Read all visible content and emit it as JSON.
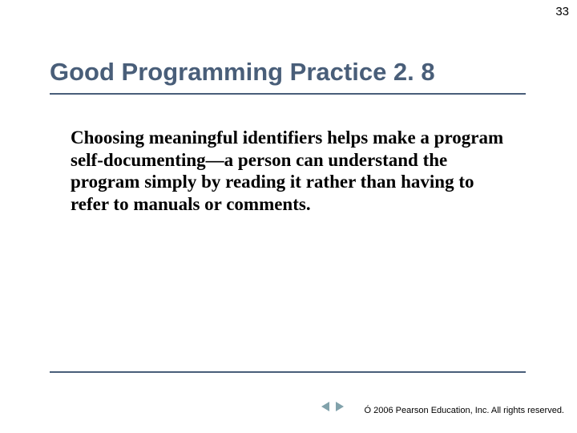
{
  "page": {
    "number": "33"
  },
  "title": "Good Programming Practice 2. 8",
  "body": "Choosing meaningful identifiers helps make a program self-documenting—a person can understand the program simply by reading it rather than having to refer to manuals or comments.",
  "footer": {
    "copyright": " 2006 Pearson Education, Inc.  All rights reserved.",
    "copyright_symbol": "Ó"
  },
  "colors": {
    "title": "#495e79",
    "rule": "#495e79",
    "arrow": "#81a2ab"
  }
}
